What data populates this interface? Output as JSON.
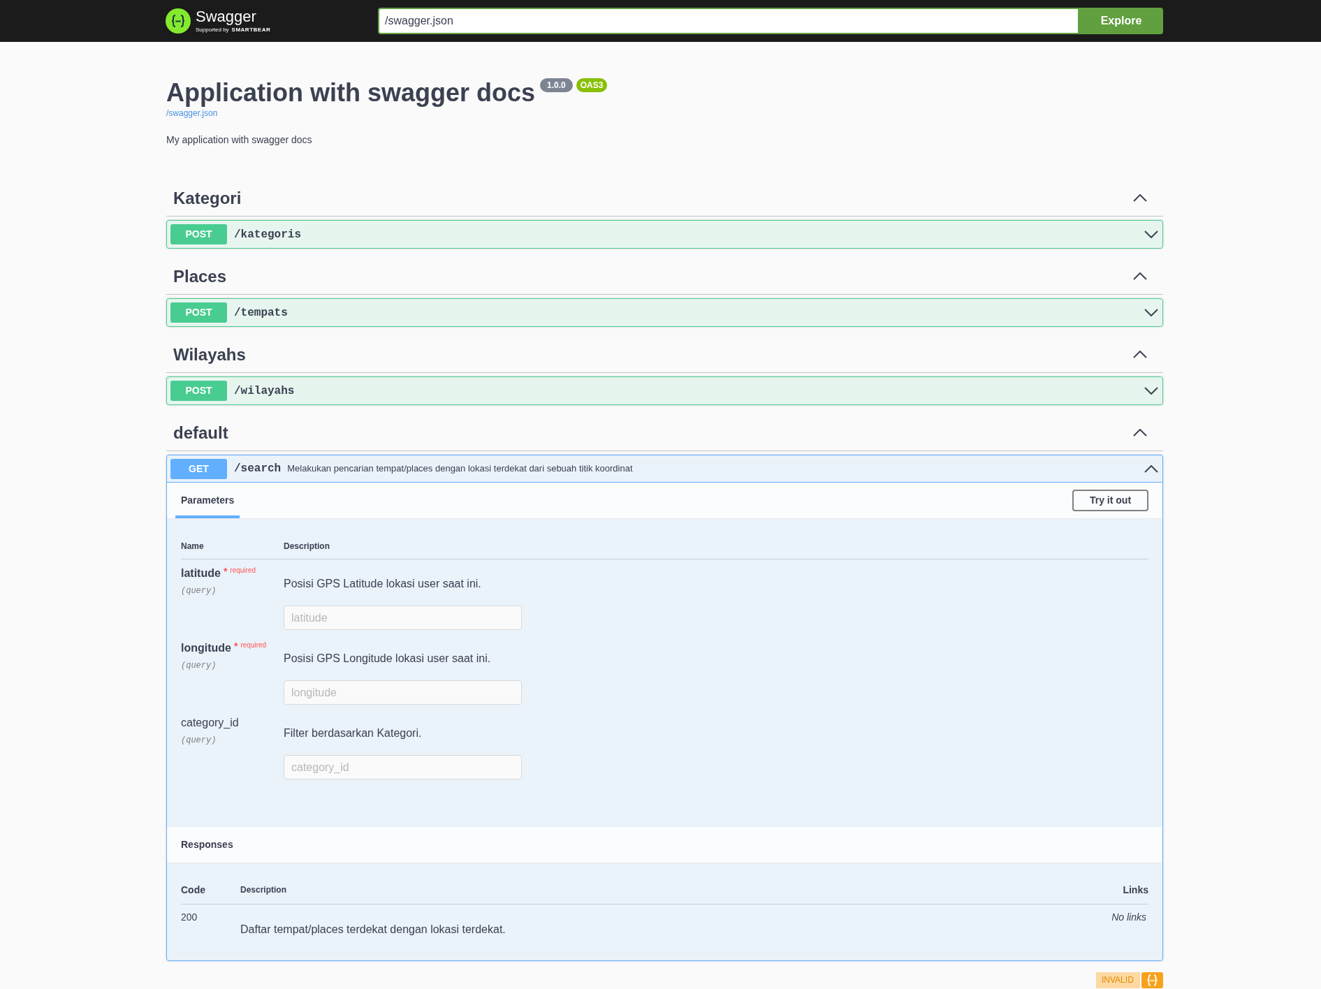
{
  "header": {
    "logo": {
      "name": "Swagger",
      "tagline": "Supported by",
      "brand": "SMARTBEAR"
    },
    "url_field": {
      "value": "/swagger.json"
    },
    "explore_button": {
      "label": "Explore"
    }
  },
  "info": {
    "title": "Application with swagger docs",
    "version": "1.0.0",
    "spec_badge": "OAS3",
    "spec_link": "/swagger.json",
    "description": "My application with swagger docs"
  },
  "tags": [
    {
      "name": "Kategori",
      "expanded": true,
      "operations": [
        {
          "method": "POST",
          "color": "#49cc90",
          "path": "/kategoris",
          "expanded": false
        }
      ]
    },
    {
      "name": "Places",
      "expanded": true,
      "operations": [
        {
          "method": "POST",
          "color": "#49cc90",
          "path": "/tempats",
          "expanded": false
        }
      ]
    },
    {
      "name": "Wilayahs",
      "expanded": true,
      "operations": [
        {
          "method": "POST",
          "color": "#49cc90",
          "path": "/wilayahs",
          "expanded": false
        }
      ]
    },
    {
      "name": "default",
      "expanded": true,
      "operations": [
        {
          "method": "GET",
          "color": "#61affe",
          "path": "/search",
          "summary": "Melakukan pencarian tempat/places dengan lokasi terdekat dari sebuah titik koordinat",
          "expanded": true,
          "tabs": [
            {
              "label": "Parameters",
              "selected": true
            }
          ],
          "try_button": "Try it out",
          "parameters": {
            "columns": [
              "Name",
              "Description"
            ],
            "rows": [
              {
                "name": "latitude",
                "required": true,
                "required_star": "*",
                "required_label": "required",
                "location": "(query)",
                "description": "Posisi GPS Latitude lokasi user saat ini.",
                "placeholder": "latitude"
              },
              {
                "name": "longitude",
                "required": true,
                "required_star": "*",
                "required_label": "required",
                "location": "(query)",
                "description": "Posisi GPS Longitude lokasi user saat ini.",
                "placeholder": "longitude"
              },
              {
                "name": "category_id",
                "required": false,
                "location": "(query)",
                "description": "Filter berdasarkan Kategori.",
                "placeholder": "category_id"
              }
            ]
          },
          "responses": {
            "title": "Responses",
            "columns": [
              "Code",
              "Description",
              "Links"
            ],
            "rows": [
              {
                "code": "200",
                "description": "Daftar tempat/places terdekat dengan lokasi terdekat.",
                "links": "No links"
              }
            ]
          }
        }
      ]
    }
  ],
  "validator": {
    "label": "INVALID"
  }
}
